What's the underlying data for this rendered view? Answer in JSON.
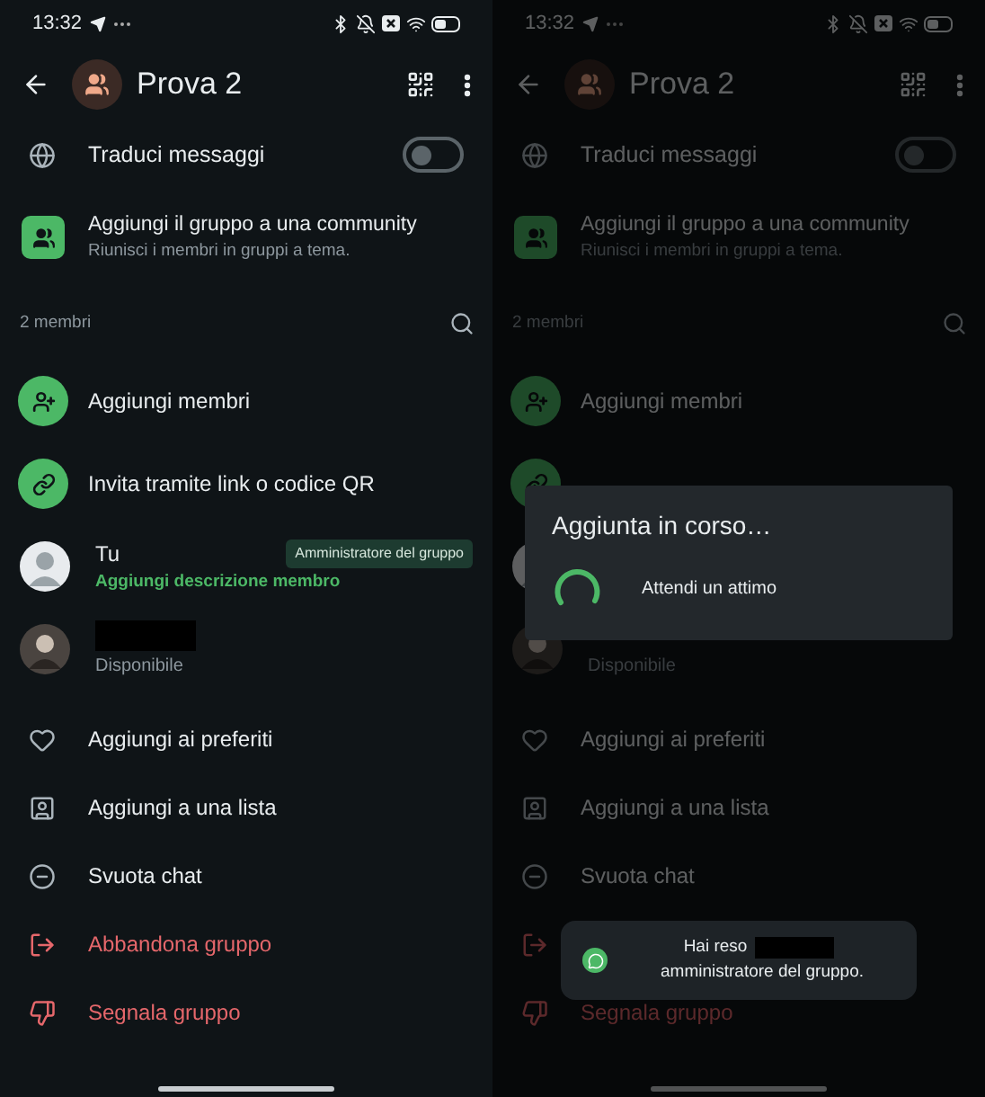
{
  "screens": [
    {
      "dimmed": false,
      "time": "13:32",
      "title": "Prova 2",
      "translate": {
        "label": "Traduci messaggi",
        "on": false
      },
      "community": {
        "title": "Aggiungi il gruppo a una community",
        "subtitle": "Riunisci i membri in gruppi a tema."
      },
      "members_count": "2 membri",
      "actions": [
        {
          "kind": "add",
          "label": "Aggiungi membri"
        },
        {
          "kind": "link",
          "label": "Invita tramite link o codice QR"
        }
      ],
      "members": [
        {
          "kind": "picture",
          "name": "Tu",
          "description": "Aggiungi descrizione membro",
          "badge": "Amministratore del gruppo"
        },
        {
          "kind": "picture",
          "name_redacted": true,
          "status": "Disponibile"
        }
      ],
      "options": [
        {
          "kind": "favorite",
          "danger": false,
          "label": "Aggiungi ai preferiti"
        },
        {
          "kind": "list",
          "danger": false,
          "label": "Aggiungi a una lista"
        },
        {
          "kind": "clear",
          "danger": false,
          "label": "Svuota chat"
        },
        {
          "kind": "leave",
          "danger": true,
          "label": "Abbandona gruppo"
        },
        {
          "kind": "report",
          "danger": true,
          "label": "Segnala gruppo"
        }
      ]
    },
    {
      "dimmed": true,
      "time": "13:32",
      "title": "Prova 2",
      "translate": {
        "label": "Traduci messaggi",
        "on": false
      },
      "community": {
        "title": "Aggiungi il gruppo a una community",
        "subtitle": "Riunisci i membri in gruppi a tema."
      },
      "members_count": "2 membri",
      "actions": [
        {
          "kind": "add",
          "label": "Aggiungi membri"
        },
        {
          "kind": "link"
        }
      ],
      "members": [
        {
          "kind": "picture"
        },
        {
          "kind": "picture",
          "status": "Disponibile"
        }
      ],
      "options": [
        {
          "kind": "favorite",
          "danger": false,
          "label": "Aggiungi ai preferiti"
        },
        {
          "kind": "list",
          "danger": false,
          "label": "Aggiungi a una lista"
        },
        {
          "kind": "clear",
          "danger": false,
          "label": "Svuota chat"
        },
        {
          "kind": "leave",
          "danger": true
        },
        {
          "kind": "report",
          "danger": true,
          "label": "Segnala gruppo"
        }
      ],
      "dialog": {
        "title": "Aggiunta in corso…",
        "message": "Attendi un attimo"
      },
      "toast": {
        "text_start": "Hai reso",
        "text_end": "amministratore del gruppo."
      }
    }
  ]
}
